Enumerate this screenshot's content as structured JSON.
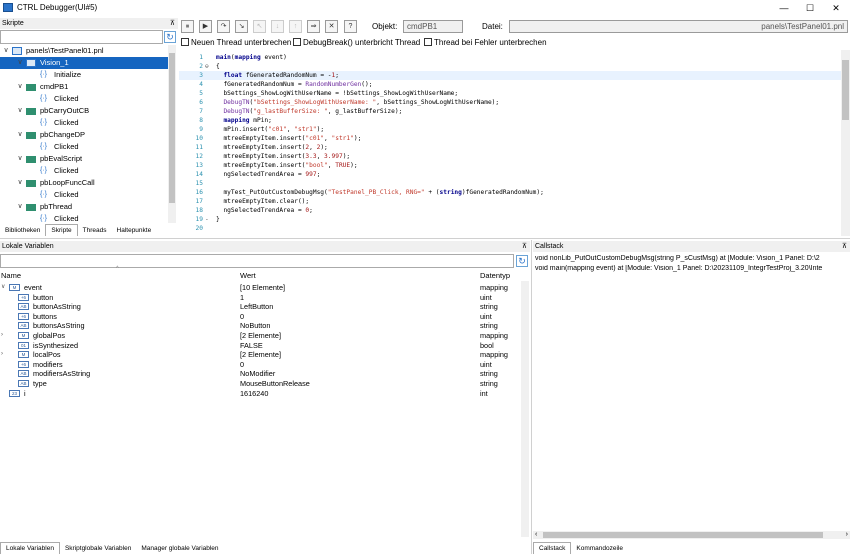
{
  "window": {
    "title": "CTRL Debugger(UI#5)",
    "controls": {
      "minimize": "—",
      "maximize": "☐",
      "close": "✕"
    }
  },
  "scripts_pane": {
    "header": "Skripte",
    "search_placeholder": "",
    "tree": [
      {
        "label": "panels\\TestPanel01.pnl",
        "level": 0,
        "kind": "panel",
        "expand": "∨"
      },
      {
        "label": "Vision_1",
        "level": 1,
        "kind": "panel",
        "expand": "∨",
        "selected": true
      },
      {
        "label": "Initialize",
        "level": 2,
        "kind": "fn"
      },
      {
        "label": "cmdPB1",
        "level": 1,
        "kind": "obj",
        "expand": "∨"
      },
      {
        "label": "Clicked",
        "level": 2,
        "kind": "fn"
      },
      {
        "label": "pbCarryOutCB",
        "level": 1,
        "kind": "obj",
        "expand": "∨"
      },
      {
        "label": "Clicked",
        "level": 2,
        "kind": "fn"
      },
      {
        "label": "pbChangeDP",
        "level": 1,
        "kind": "obj",
        "expand": "∨"
      },
      {
        "label": "Clicked",
        "level": 2,
        "kind": "fn"
      },
      {
        "label": "pbEvalScript",
        "level": 1,
        "kind": "obj",
        "expand": "∨"
      },
      {
        "label": "Clicked",
        "level": 2,
        "kind": "fn"
      },
      {
        "label": "pbLoopFuncCall",
        "level": 1,
        "kind": "obj",
        "expand": "∨"
      },
      {
        "label": "Clicked",
        "level": 2,
        "kind": "fn"
      },
      {
        "label": "pbThread",
        "level": 1,
        "kind": "obj",
        "expand": "∨"
      },
      {
        "label": "Clicked",
        "level": 2,
        "kind": "fn"
      }
    ],
    "tabs": [
      "Bibliotheken",
      "Skripte",
      "Threads",
      "Haltepunkte"
    ],
    "active_tab": "Skripte"
  },
  "toolbar": {
    "buttons": [
      "pause-icon",
      "play-icon",
      "step-over-icon",
      "step-into-icon",
      "step-out-icon",
      "run-to-cursor-icon",
      "up-icon",
      "next-icon",
      "stop-icon",
      "help-icon"
    ],
    "button_glyphs": [
      "⏸",
      "▶",
      "↷",
      "↘",
      "↖",
      "↓",
      "↑",
      "⇒",
      "✕",
      "?"
    ],
    "objekt_label": "Objekt:",
    "objekt_value": "cmdPB1",
    "datei_label": "Datei:",
    "datei_value": "panels\\TestPanel01.pnl"
  },
  "options": [
    {
      "label": "Neuen Thread unterbrechen",
      "checked": false
    },
    {
      "label": "DebugBreak() unterbricht Thread",
      "checked": false
    },
    {
      "label": "Thread bei Fehler unterbrechen",
      "checked": false
    }
  ],
  "code": [
    {
      "n": "1",
      "text": "main(mapping event)"
    },
    {
      "n": "2",
      "fold": "⊖",
      "text": "{"
    },
    {
      "n": "3",
      "text": "  float fGeneratedRandomNum = -1;",
      "highlight": true
    },
    {
      "n": "4",
      "text": "  fGeneratedRandomNum = RandomNumberGen();"
    },
    {
      "n": "5",
      "text": "  bSettings_ShowLogWithUserName = !bSettings_ShowLogWithUserName;"
    },
    {
      "n": "6",
      "text": "  DebugTN(\"bSettings_ShowLogWithUserName: \", bSettings_ShowLogWithUserName);"
    },
    {
      "n": "7",
      "text": "  DebugTN(\"g_lastBufferSize: \", g_lastBufferSize);"
    },
    {
      "n": "8",
      "text": "  mapping mPin;"
    },
    {
      "n": "9",
      "text": "  mPin.insert(\"c01\", \"str1\");"
    },
    {
      "n": "10",
      "text": "  mtreeEmptyItem.insert(\"c01\", \"str1\");"
    },
    {
      "n": "11",
      "text": "  mtreeEmptyItem.insert(2, 2);"
    },
    {
      "n": "12",
      "text": "  mtreeEmptyItem.insert(3.3, 3.997);"
    },
    {
      "n": "13",
      "text": "  mtreeEmptyItem.insert(\"bool\", TRUE);"
    },
    {
      "n": "14",
      "text": "  ngSelectedTrendArea = 997;"
    },
    {
      "n": "15",
      "text": ""
    },
    {
      "n": "16",
      "text": "  myTest_PutOutCustomDebugMsg(\"TestPanel_PB_Click, RNG=\" + (string)fGeneratedRandomNum);"
    },
    {
      "n": "17",
      "text": "  mtreeEmptyItem.clear();"
    },
    {
      "n": "18",
      "text": "  ngSelectedTrendArea = 0;"
    },
    {
      "n": "19",
      "fold": "-",
      "text": "}"
    },
    {
      "n": "20",
      "text": ""
    }
  ],
  "locals_pane": {
    "header": "Lokale Variablen",
    "columns": {
      "name": "Name",
      "value": "Wert",
      "type": "Datentyp"
    },
    "rows": [
      {
        "expand": "∨",
        "icon": "M",
        "name": "event",
        "value": "[10 Elemente]",
        "type": "mapping",
        "level": 0
      },
      {
        "icon": "+6",
        "name": "button",
        "value": "1",
        "type": "uint",
        "level": 1
      },
      {
        "icon": "AB",
        "name": "buttonAsString",
        "value": "LeftButton",
        "type": "string",
        "level": 1
      },
      {
        "icon": "+6",
        "name": "buttons",
        "value": "0",
        "type": "uint",
        "level": 1
      },
      {
        "icon": "AB",
        "name": "buttonsAsString",
        "value": "NoButton",
        "type": "string",
        "level": 1
      },
      {
        "expand": "›",
        "icon": "M",
        "name": "globalPos",
        "value": "[2 Elemente]",
        "type": "mapping",
        "level": 1
      },
      {
        "icon": "01",
        "name": "isSynthesized",
        "value": "FALSE",
        "type": "bool",
        "level": 1
      },
      {
        "expand": "›",
        "icon": "M",
        "name": "localPos",
        "value": "[2 Elemente]",
        "type": "mapping",
        "level": 1
      },
      {
        "icon": "+6",
        "name": "modifiers",
        "value": "0",
        "type": "uint",
        "level": 1
      },
      {
        "icon": "AB",
        "name": "modifiersAsString",
        "value": "NoModifier",
        "type": "string",
        "level": 1
      },
      {
        "icon": "AB",
        "name": "type",
        "value": "MouseButtonRelease",
        "type": "string",
        "level": 1
      },
      {
        "icon": "23",
        "name": "i",
        "value": "1616240",
        "type": "int",
        "level": 0
      }
    ],
    "tabs": [
      "Lokale Variablen",
      "Skriptglobale Variablen",
      "Manager globale Variablen"
    ],
    "active_tab": "Lokale Variablen"
  },
  "callstack_pane": {
    "header": "Callstack",
    "lines": [
      "void nonLib_PutOutCustomDebugMsg(string P_sCustMsg) at [Module: Vision_1 Panel: D:\\2",
      "void main(mapping event) at [Module: Vision_1 Panel: D:\\20231109_IntegrTestProj_3.20\\Inte"
    ],
    "tabs": [
      "Callstack",
      "Kommandozeile"
    ],
    "active_tab": "Callstack"
  },
  "colors": {
    "selection": "#1565c0",
    "line_numbers": "#2b91af",
    "keyword": "#00008b",
    "string": "#c0392b"
  }
}
